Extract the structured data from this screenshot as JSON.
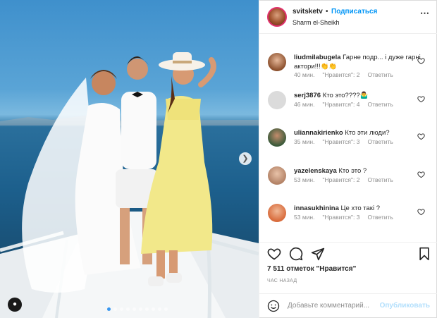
{
  "post": {
    "username": "svitsketv",
    "separator": "•",
    "follow_label": "Подписаться",
    "location": "Sharm el-Sheikh",
    "more_icon": "more-horizontal-icon"
  },
  "comments": [
    {
      "username": "liudmilabugela",
      "text": "Гарне подр... і дуже гарні актори!!!👏👏",
      "time": "40 мин.",
      "likes": "\"Нравится\": 2",
      "reply": "Ответить"
    },
    {
      "username": "serj3876",
      "text": "Кто это????🤷‍♂️",
      "time": "46 мин.",
      "likes": "\"Нравится\": 4",
      "reply": "Ответить"
    },
    {
      "username": "uliannakirienko",
      "text": "Кто эти люди?",
      "time": "35 мин.",
      "likes": "\"Нравится\": 3",
      "reply": "Ответить"
    },
    {
      "username": "yazelenskaya",
      "text": "Кто это ?",
      "time": "53 мин.",
      "likes": "\"Нравится\": 2",
      "reply": "Ответить"
    },
    {
      "username": "innasukhinina",
      "text": "Це хто такі ?",
      "time": "53 мин.",
      "likes": "\"Нравится\": 3",
      "reply": "Ответить"
    }
  ],
  "footer": {
    "likes_count": "7 511 отметок \"Нравится\"",
    "time_ago": "ЧАС НАЗАД",
    "comment_placeholder": "Добавьте комментарий...",
    "post_label": "Опубликовать"
  },
  "colors": {
    "link": "#0095f6",
    "muted": "#8e8e8e",
    "post_disabled": "#b2dffc"
  }
}
